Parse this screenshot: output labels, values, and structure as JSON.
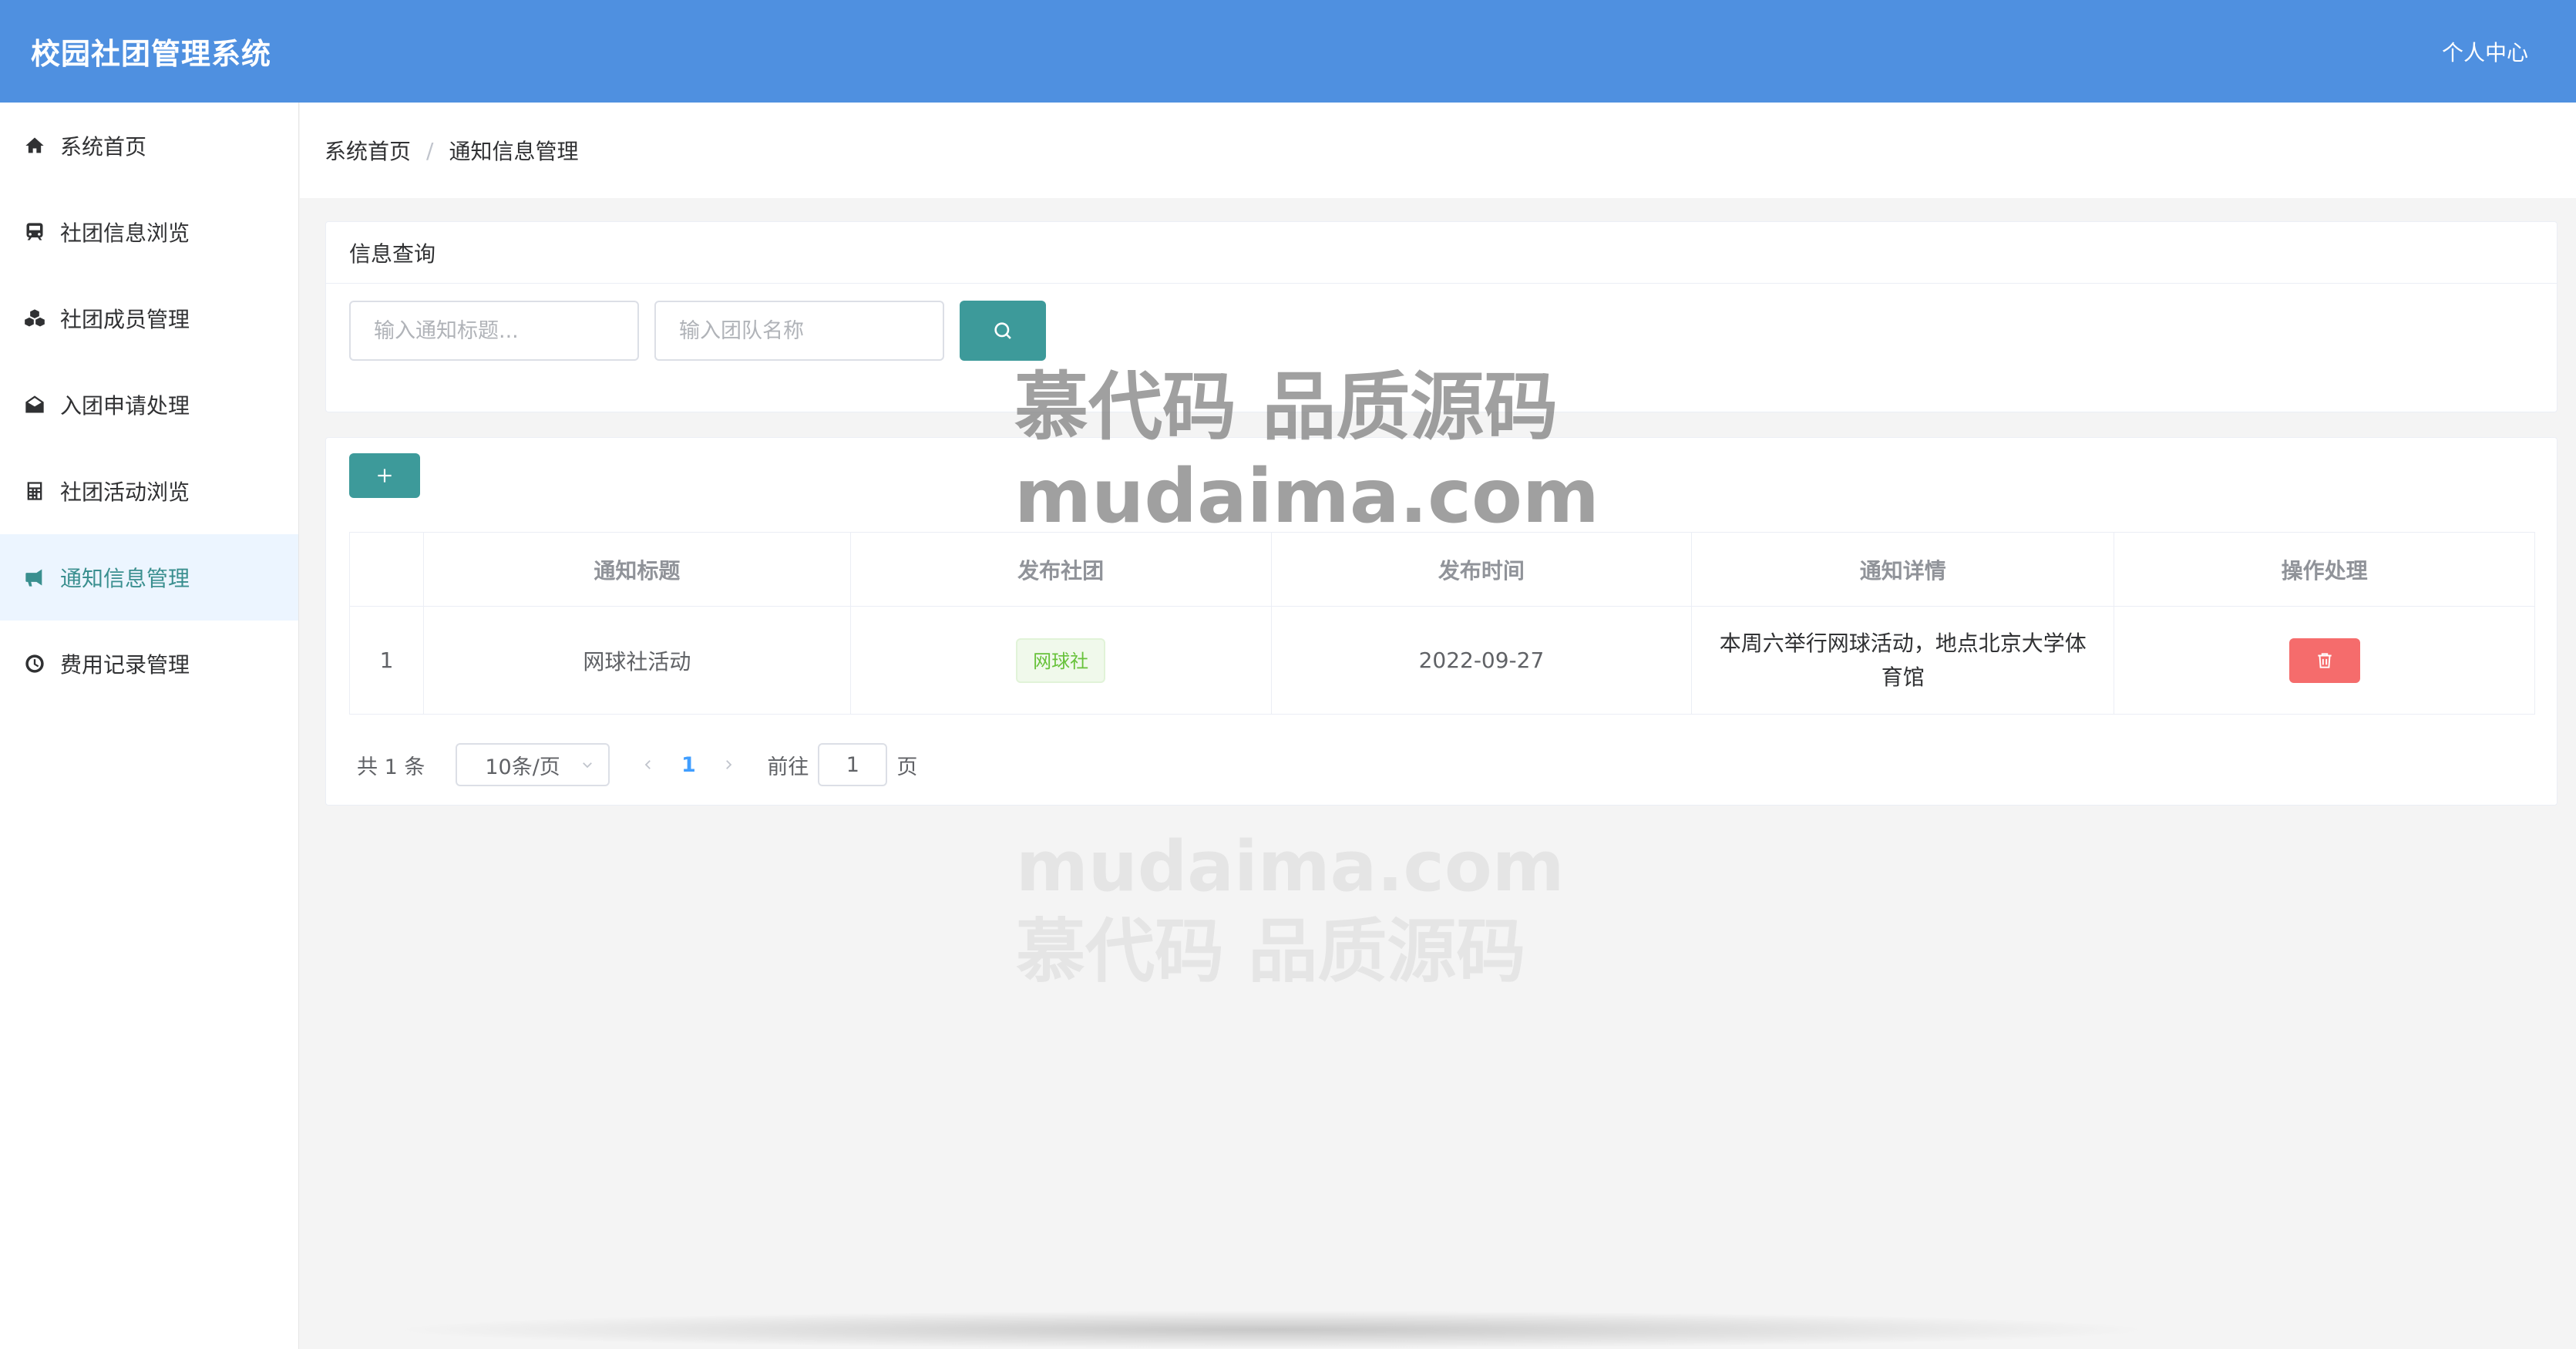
{
  "header": {
    "title": "校园社团管理系统",
    "personal_center": "个人中心"
  },
  "sidebar": {
    "items": [
      {
        "label": "系统首页",
        "icon": "home-icon"
      },
      {
        "label": "社团信息浏览",
        "icon": "train-icon"
      },
      {
        "label": "社团成员管理",
        "icon": "cubes-icon"
      },
      {
        "label": "入团申请处理",
        "icon": "envelope-open-icon"
      },
      {
        "label": "社团活动浏览",
        "icon": "calculator-icon"
      },
      {
        "label": "通知信息管理",
        "icon": "bullhorn-icon",
        "active": true
      },
      {
        "label": "费用记录管理",
        "icon": "clock-icon"
      }
    ]
  },
  "breadcrumb": {
    "home": "系统首页",
    "separator": "/",
    "current": "通知信息管理"
  },
  "query": {
    "title": "信息查询",
    "title_placeholder": "输入通知标题...",
    "team_placeholder": "输入团队名称"
  },
  "table": {
    "headers": [
      "",
      "通知标题",
      "发布社团",
      "发布时间",
      "通知详情",
      "操作处理"
    ],
    "rows": [
      {
        "index": "1",
        "title": "网球社活动",
        "club": "网球社",
        "time": "2022-09-27",
        "detail": "本周六举行网球活动，地点北京大学体育馆"
      }
    ]
  },
  "pagination": {
    "total": "共 1 条",
    "page_size": "10条/页",
    "current_page": "1",
    "goto_label": "前往",
    "goto_value": "1",
    "page_unit": "页"
  },
  "watermark": {
    "line1": "慕代码 品质源码",
    "line2": "mudaima.com"
  },
  "colors": {
    "header": "#4f90e0",
    "accent": "#3d9a9a",
    "danger": "#f56c6c",
    "tag_green": "#67c23a"
  }
}
